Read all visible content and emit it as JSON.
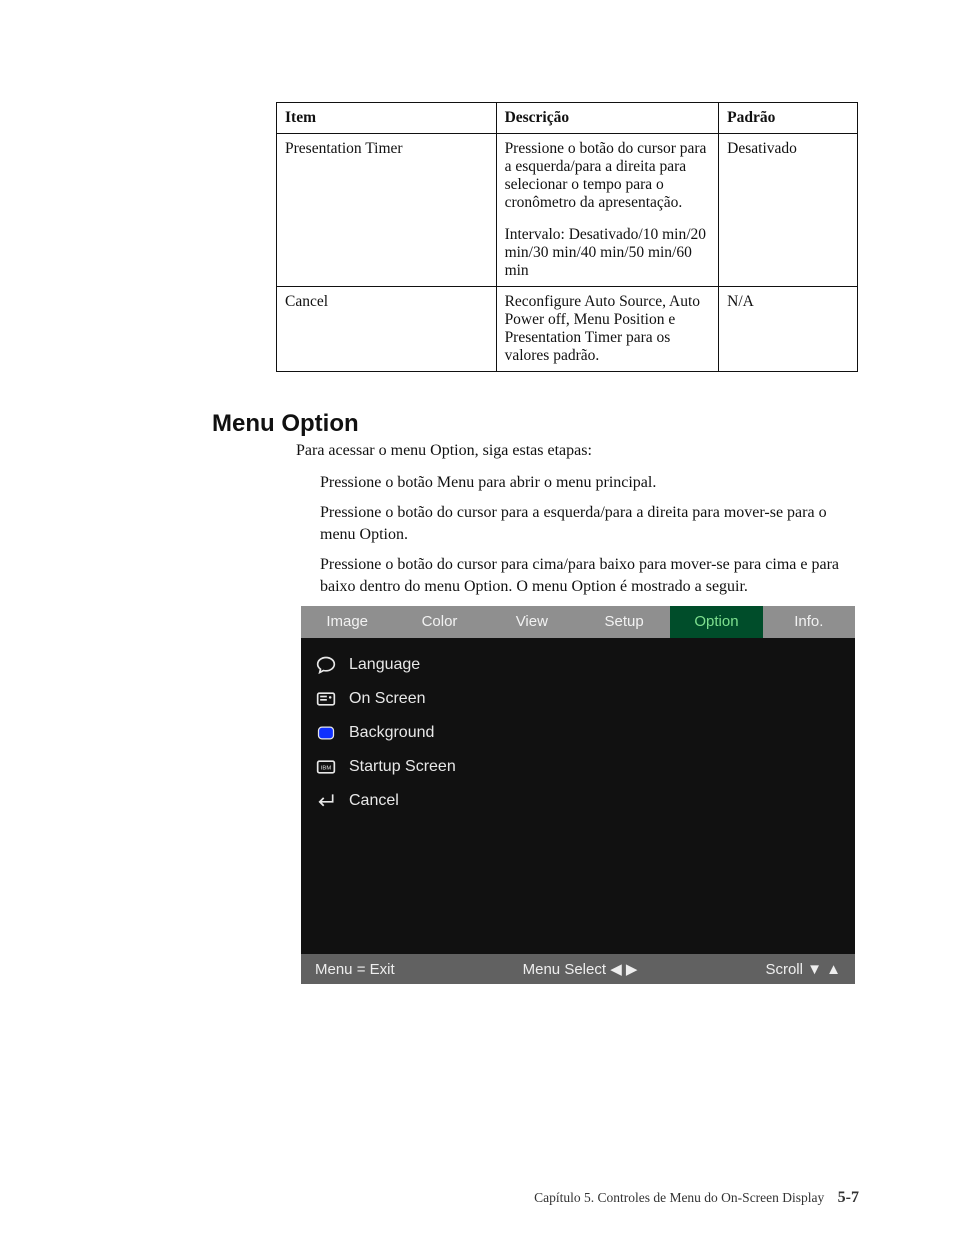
{
  "table": {
    "headers": {
      "item": "Item",
      "desc": "Descrição",
      "pad": "Padrão"
    },
    "rows": [
      {
        "item": "Presentation Timer",
        "desc_p1": "Pressione o botão do cursor para a esquerda/para a direita para selecionar o tempo para o cronômetro da apresentação.",
        "desc_p2": "Intervalo: Desativado/10 min/20 min/30 min/40 min/50 min/60 min",
        "pad": "Desativado"
      },
      {
        "item": "Cancel",
        "desc_p1": "Reconfigure Auto Source, Auto Power off, Menu Position e Presentation Timer para os valores padrão.",
        "desc_p2": "",
        "pad": "N/A"
      }
    ]
  },
  "section": {
    "heading": "Menu Option",
    "lead": "Para acessar o menu Option, siga estas etapas:",
    "step1": "Pressione o botão Menu para abrir o menu principal.",
    "step2": "Pressione o botão do cursor para a esquerda/para a direita para mover-se para o menu Option.",
    "step3": "Pressione o botão do cursor para cima/para baixo para mover-se para cima e para baixo dentro do menu Option. O menu Option é mostrado a seguir."
  },
  "osd": {
    "tabs": {
      "image": "Image",
      "color": "Color",
      "view": "View",
      "setup": "Setup",
      "option": "Option",
      "info": "Info."
    },
    "items": {
      "language": "Language",
      "onscreen": "On Screen",
      "background": "Background",
      "startup": "Startup Screen",
      "cancel": "Cancel"
    },
    "footer": {
      "left": "Menu = Exit",
      "mid_label": "Menu Select",
      "mid_arrows": "◀ ▶",
      "right_label": "Scroll",
      "right_arrows": "▼ ▲"
    }
  },
  "footer": {
    "chapter": "Capítulo 5. Controles de Menu do On-Screen Display",
    "page": "5-7"
  }
}
